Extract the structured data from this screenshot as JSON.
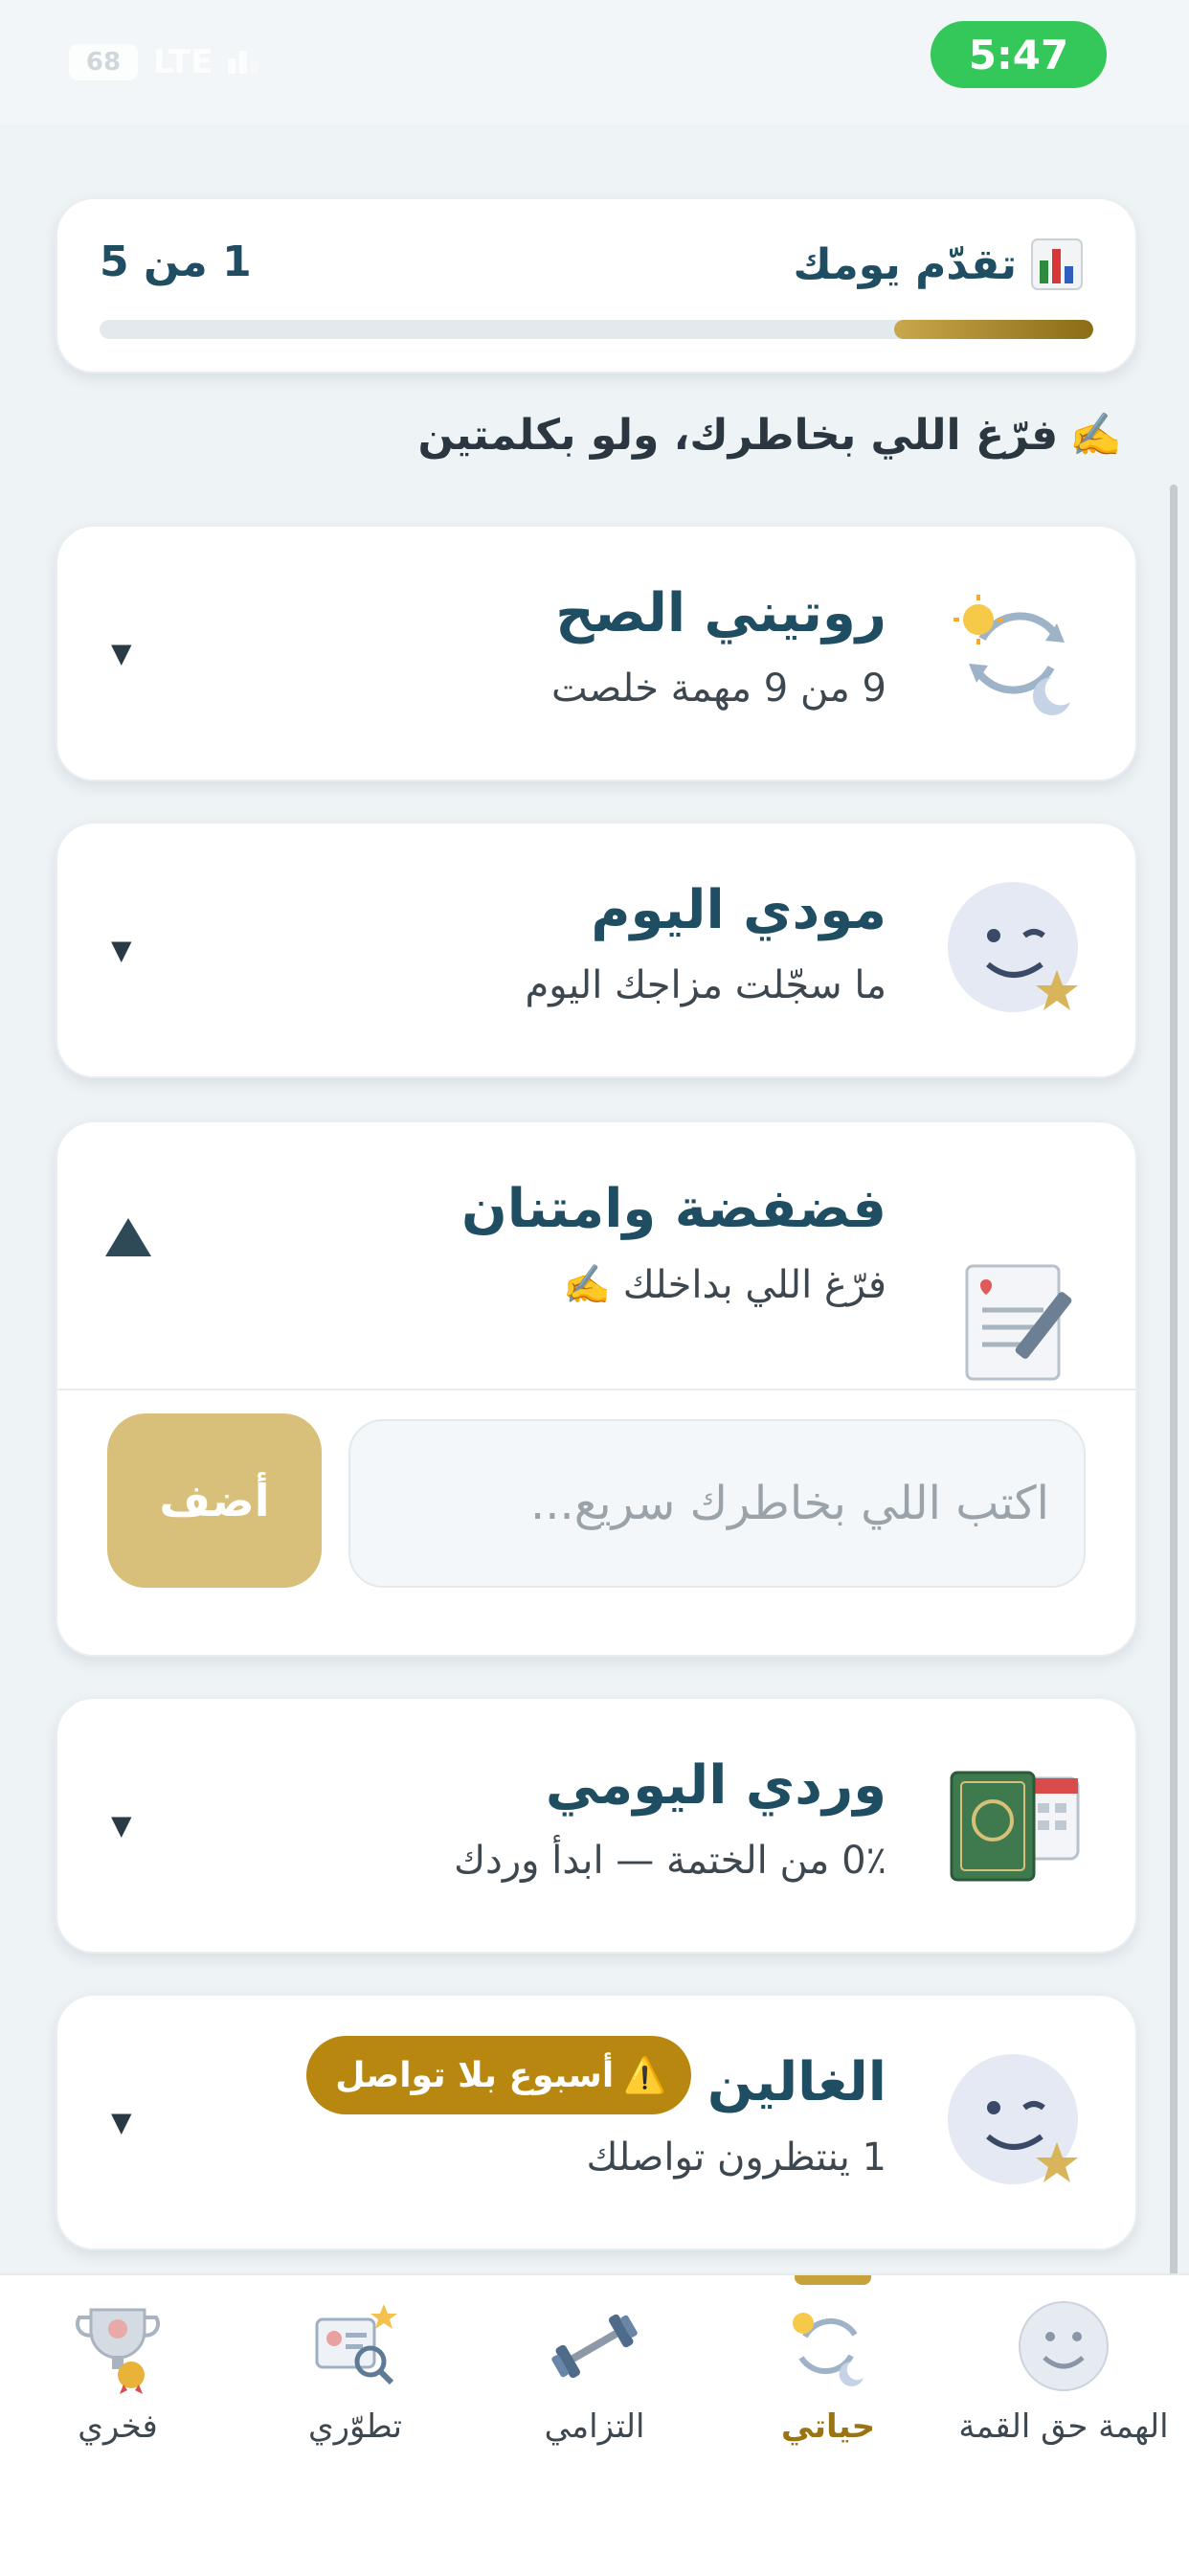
{
  "status_bar": {
    "time": "5:47",
    "battery": "68",
    "network": "LTE"
  },
  "progress": {
    "title": "تقدّم يومك",
    "title_icon": "bar-chart-icon",
    "count": "1 من 5",
    "fraction": 0.2
  },
  "hint": {
    "text": "فرّغ اللي بخاطرك، ولو بكلمتين",
    "icon": "✍️"
  },
  "sections": [
    {
      "id": "routine",
      "title": "روتيني الصح",
      "subtitle": "9 من 9 مهمة خلصت",
      "icon": "sun-moon-cycle-icon",
      "expanded": false
    },
    {
      "id": "mood",
      "title": "مودي اليوم",
      "subtitle": "ما سجّلت مزاجك اليوم",
      "icon": "winking-face-icon",
      "expanded": false
    },
    {
      "id": "vent",
      "title": "فضفضة وامتنان",
      "subtitle": "فرّغ اللي بداخلك ✍️",
      "icon": "notepad-pen-icon",
      "expanded": true,
      "input_placeholder": "اكتب اللي بخاطرك سريع...",
      "add_label": "أضف"
    },
    {
      "id": "wird",
      "title": "وردي اليومي",
      "subtitle": "0٪ من الختمة — ابدأ وردك",
      "icon": "quran-calendar-icon",
      "expanded": false
    },
    {
      "id": "dear",
      "title": "الغالين",
      "subtitle": "1 ينتظرون تواصلك",
      "icon": "winking-face-icon",
      "expanded": false,
      "badge": "أسبوع بلا تواصل",
      "badge_icon": "⚠️"
    }
  ],
  "nav": [
    {
      "label": "الهمة حق القمة",
      "icon": "smile-face-icon",
      "active": false
    },
    {
      "label": "حياتي",
      "icon": "sun-moon-cycle-icon",
      "active": true
    },
    {
      "label": "التزامي",
      "icon": "dumbbell-icon",
      "active": false
    },
    {
      "label": "تطوّري",
      "icon": "profile-search-icon",
      "active": false
    },
    {
      "label": "فخري",
      "icon": "trophy-icon",
      "active": false
    }
  ],
  "colors": {
    "accent": "#c9a13a",
    "primary_text": "#1f4e63",
    "badge": "#b8870f",
    "add_button": "#d8c07a"
  }
}
